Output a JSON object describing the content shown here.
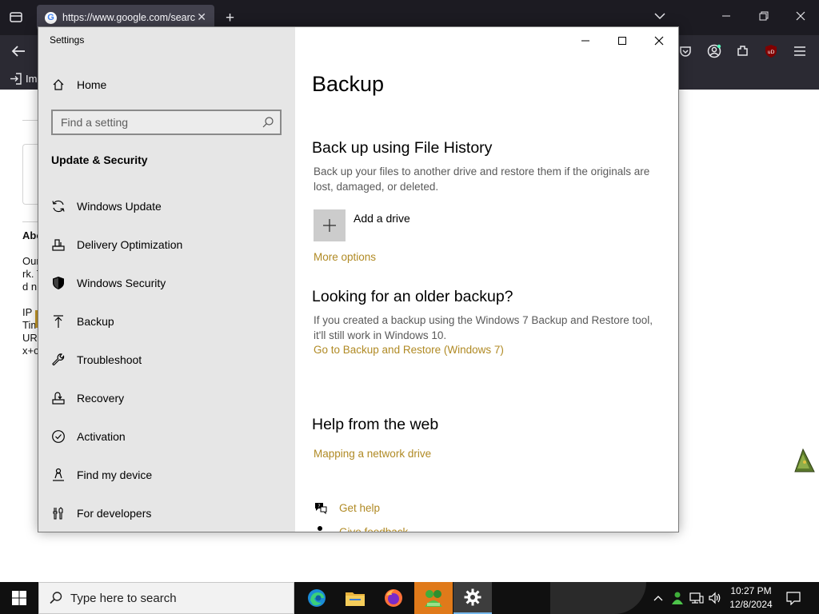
{
  "browser": {
    "tab_url": "https://www.google.com/searc",
    "bookmark_text": "Im",
    "content_lines": [
      "Abo",
      "Our",
      "rk. T",
      "d n",
      "IP",
      "Tim",
      "URI",
      "x+c"
    ],
    "icons": [
      "tab-list-icon",
      "google-favicon",
      "close-tab-icon",
      "new-tab-icon",
      "tab-overflow-icon",
      "minimize-icon",
      "restore-icon",
      "close-icon",
      "back-icon",
      "pocket-icon",
      "account-icon",
      "extensions-icon",
      "ublock-icon",
      "menu-icon",
      "import-icon"
    ],
    "ublock_badge": "uD"
  },
  "settings": {
    "app_title": "Settings",
    "home_label": "Home",
    "search_placeholder": "Find a setting",
    "section_title": "Update & Security",
    "nav_items": [
      {
        "label": "Windows Update",
        "icon": "sync-icon"
      },
      {
        "label": "Delivery Optimization",
        "icon": "delivery-optimization-icon"
      },
      {
        "label": "Windows Security",
        "icon": "shield-icon"
      },
      {
        "label": "Backup",
        "icon": "backup-arrow-icon"
      },
      {
        "label": "Troubleshoot",
        "icon": "wrench-icon"
      },
      {
        "label": "Recovery",
        "icon": "recovery-icon"
      },
      {
        "label": "Activation",
        "icon": "check-circle-icon"
      },
      {
        "label": "Find my device",
        "icon": "person-location-icon"
      },
      {
        "label": "For developers",
        "icon": "developer-tools-icon"
      }
    ],
    "page_title": "Backup",
    "file_history": {
      "heading": "Back up using File History",
      "description": "Back up your files to another drive and restore them if the originals are lost, damaged, or deleted.",
      "add_drive_label": "Add a drive",
      "more_options": "More options"
    },
    "older_backup": {
      "heading": "Looking for an older backup?",
      "description": "If you created a backup using the Windows 7 Backup and Restore tool, it'll still work in Windows 10.",
      "link": "Go to Backup and Restore (Windows 7)"
    },
    "web_help": {
      "heading": "Help from the web",
      "link": "Mapping a network drive"
    },
    "get_help": "Get help",
    "give_feedback": "Give feedback",
    "accent_color": "#b08a24",
    "sidebar_bg": "#e6e6e6"
  },
  "taskbar": {
    "search_placeholder": "Type here to search",
    "apps": [
      "edge-icon",
      "file-explorer-icon",
      "firefox-icon",
      "game-icon",
      "settings-gear-icon"
    ],
    "time": "10:27 PM",
    "date": "12/8/2024"
  }
}
